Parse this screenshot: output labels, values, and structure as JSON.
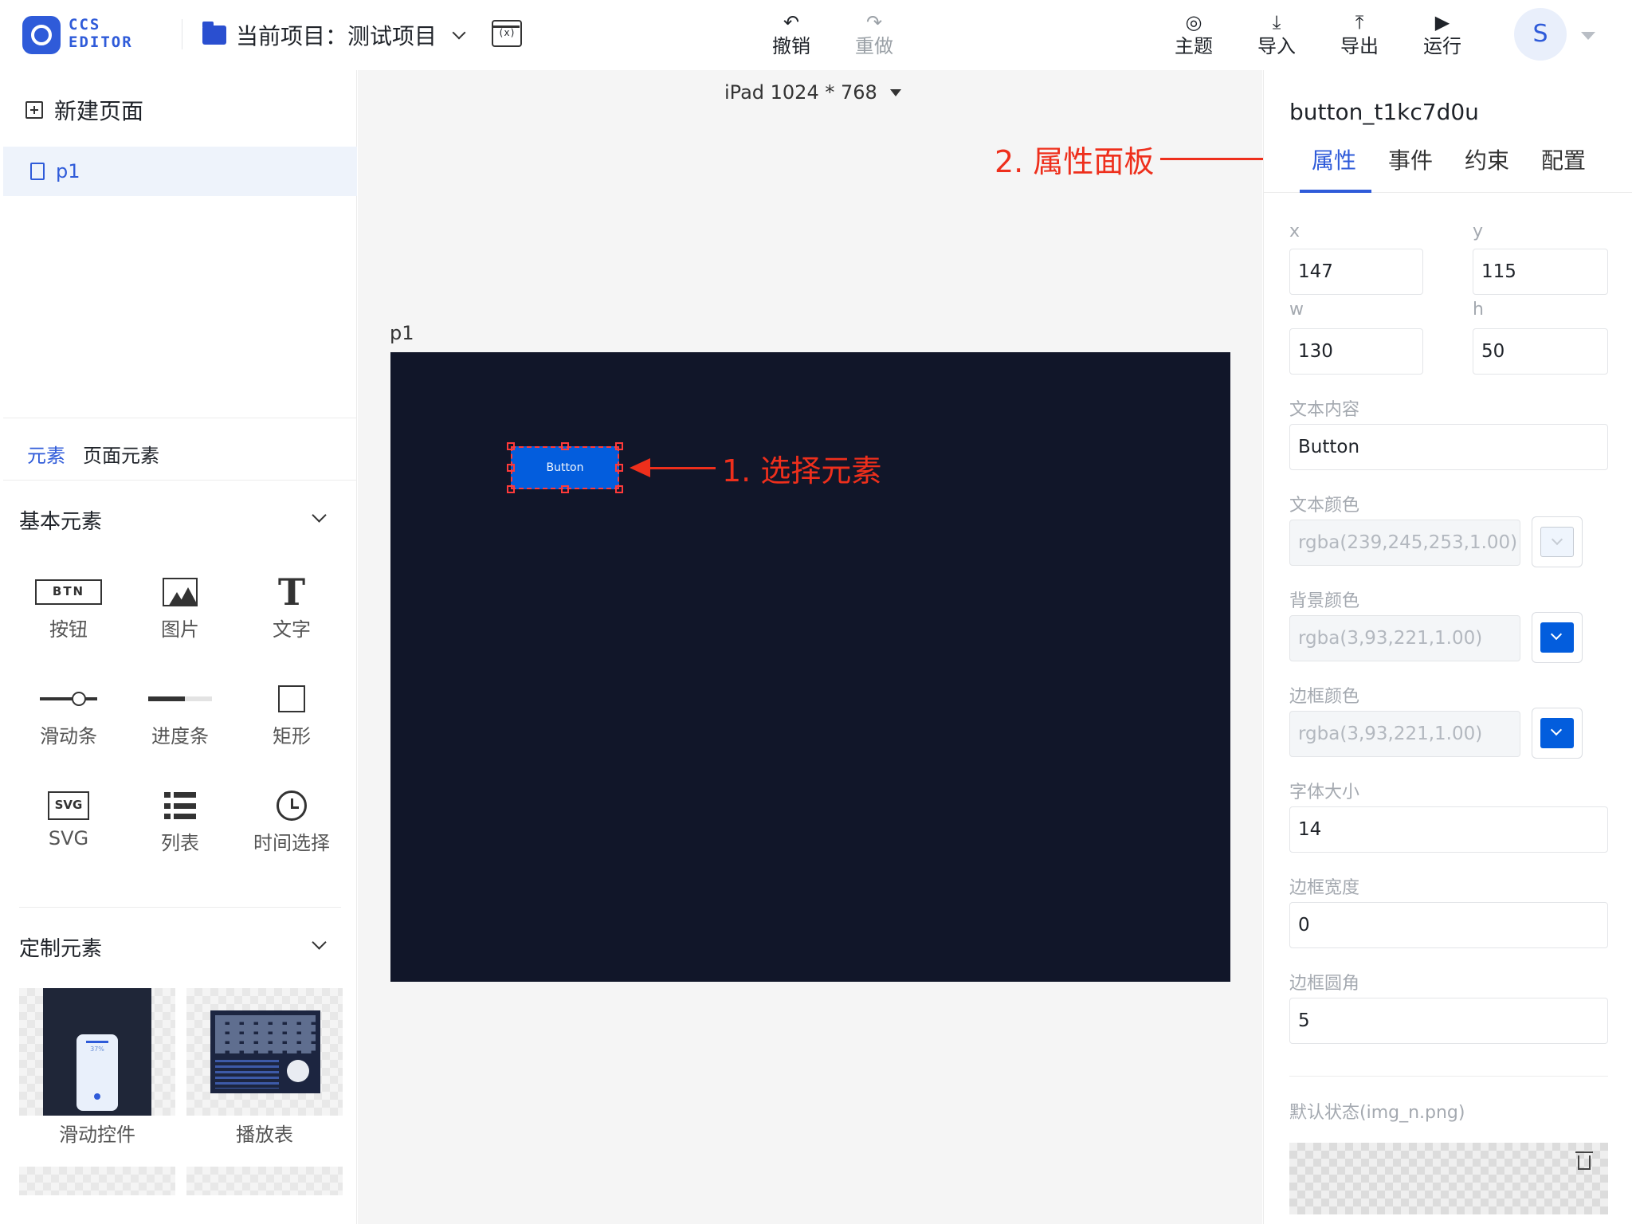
{
  "app": {
    "logo_text": "CCS EDITOR",
    "project_label": "当前项目：",
    "project_name": "测试项目",
    "var_button": "(x)"
  },
  "toolbar": {
    "undo": {
      "icon": "undo-icon",
      "label": "撤销"
    },
    "redo": {
      "icon": "redo-icon",
      "label": "重做"
    },
    "theme": {
      "icon": "palette-icon",
      "label": "主题"
    },
    "import": {
      "icon": "import-icon",
      "label": "导入"
    },
    "export": {
      "icon": "export-icon",
      "label": "导出"
    },
    "run": {
      "icon": "run-icon",
      "label": "运行"
    },
    "avatar": "S"
  },
  "sidebar": {
    "new_page": "新建页面",
    "pages": [
      {
        "name": "p1"
      }
    ],
    "tabs": [
      "元素",
      "页面元素"
    ],
    "basic_section": "基本元素",
    "basic_elements": [
      {
        "icon": "BTN",
        "label": "按钮"
      },
      {
        "icon": "image-icon",
        "label": "图片"
      },
      {
        "icon": "T",
        "label": "文字"
      },
      {
        "icon": "slider-icon",
        "label": "滑动条"
      },
      {
        "icon": "progress-icon",
        "label": "进度条"
      },
      {
        "icon": "rect-icon",
        "label": "矩形"
      },
      {
        "icon": "SVG",
        "label": "SVG"
      },
      {
        "icon": "list-icon",
        "label": "列表"
      },
      {
        "icon": "clock-icon",
        "label": "时间选择"
      }
    ],
    "custom_section": "定制元素",
    "custom_elements": [
      {
        "label": "滑动控件",
        "preview_text": "37%"
      },
      {
        "label": "播放表"
      }
    ]
  },
  "canvas": {
    "device": "iPad 1024 * 768",
    "page_name": "p1",
    "button_text": "Button",
    "bg_color": "#111629"
  },
  "annotations": {
    "select": "1. 选择元素",
    "panel": "2. 属性面板"
  },
  "inspector": {
    "title": "button_t1kc7d0u",
    "tabs": [
      "属性",
      "事件",
      "约束",
      "配置"
    ],
    "fields": {
      "x_label": "x",
      "x": "147",
      "y_label": "y",
      "y": "115",
      "w_label": "w",
      "w": "130",
      "h_label": "h",
      "h": "50",
      "text_label": "文本内容",
      "text": "Button",
      "text_color_label": "文本颜色",
      "text_color": "rgba(239,245,253,1.00)",
      "bg_color_label": "背景颜色",
      "bg_color": "rgba(3,93,221,1.00)",
      "border_color_label": "边框颜色",
      "border_color": "rgba(3,93,221,1.00)",
      "font_size_label": "字体大小",
      "font_size": "14",
      "border_width_label": "边框宽度",
      "border_width": "0",
      "border_radius_label": "边框圆角",
      "border_radius": "5",
      "default_state_label": "默认状态(img_n.png)"
    }
  },
  "colors": {
    "accent": "#2f5bd9",
    "annotation": "#ee2f1c",
    "button_bg": "#035ddd",
    "text_swatch": "#eff5fd"
  }
}
